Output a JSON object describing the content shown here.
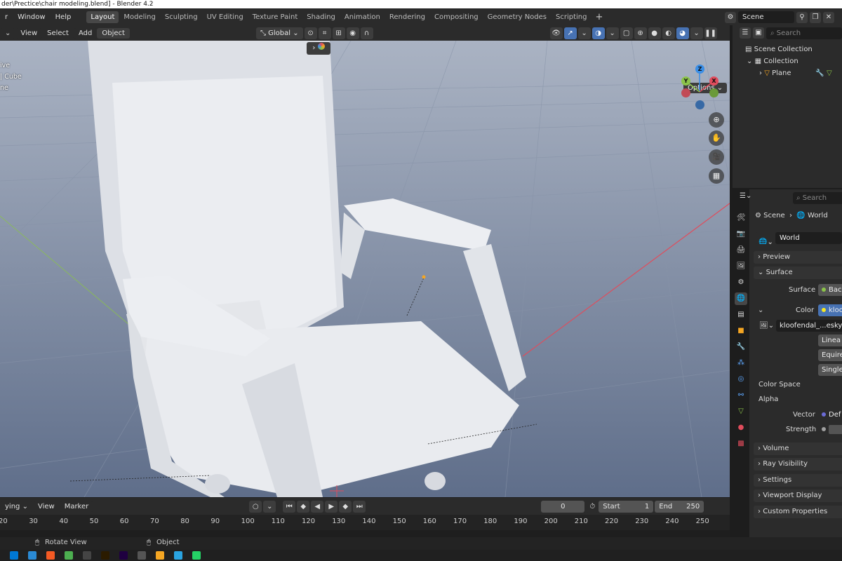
{
  "title": "der\\Prectice\\chair modeling.blend] - Blender 4.2",
  "menu": [
    "r",
    "Window",
    "Help"
  ],
  "workspaces": [
    "Layout",
    "Modeling",
    "Sculpting",
    "UV Editing",
    "Texture Paint",
    "Shading",
    "Animation",
    "Rendering",
    "Compositing",
    "Geometry Nodes",
    "Scripting"
  ],
  "active_workspace": "Layout",
  "scene": "Scene",
  "viewport": {
    "menus": [
      "View",
      "Select",
      "Add",
      "Object"
    ],
    "orientation": "Global",
    "options_label": "Options",
    "overlay_lines": [
      "ive",
      "| Cube",
      "ne"
    ]
  },
  "gizmo": {
    "z": "Z",
    "y": "Y",
    "x": "X"
  },
  "outliner": {
    "search_placeholder": "Search",
    "items": [
      "Scene Collection",
      "Collection",
      "Plane"
    ]
  },
  "properties": {
    "search_placeholder": "Search",
    "breadcrumb_scene": "Scene",
    "breadcrumb_world": "World",
    "world_name": "World",
    "preview": "Preview",
    "surface_section": "Surface",
    "surface_label": "Surface",
    "surface_value": "Bac",
    "color_label": "Color",
    "color_value": "kloo",
    "image_name": "kloofendal_...esky_",
    "interp": "Linea",
    "projection": "Equire",
    "single": "Single",
    "color_space": "Color Space",
    "alpha": "Alpha",
    "vector_label": "Vector",
    "vector_value": "Def",
    "strength_label": "Strength",
    "sections": [
      "Volume",
      "Ray Visibility",
      "Settings",
      "Viewport Display",
      "Custom Properties"
    ]
  },
  "timeline": {
    "playing_label": "ying",
    "menus": [
      "View",
      "Marker"
    ],
    "current_frame": "0",
    "start_label": "Start",
    "start_value": "1",
    "end_label": "End",
    "end_value": "250",
    "ticks": [
      "20",
      "30",
      "40",
      "50",
      "60",
      "70",
      "80",
      "90",
      "100",
      "110",
      "120",
      "130",
      "140",
      "150",
      "160",
      "170",
      "180",
      "190",
      "200",
      "210",
      "220",
      "230",
      "240",
      "250"
    ]
  },
  "status": {
    "rotate": "Rotate View",
    "object": "Object"
  },
  "colors": {
    "accent": "#4772b3",
    "x_axis": "#e04c5c",
    "y_axis": "#8bc34a",
    "z_axis": "#3a8ee6"
  }
}
